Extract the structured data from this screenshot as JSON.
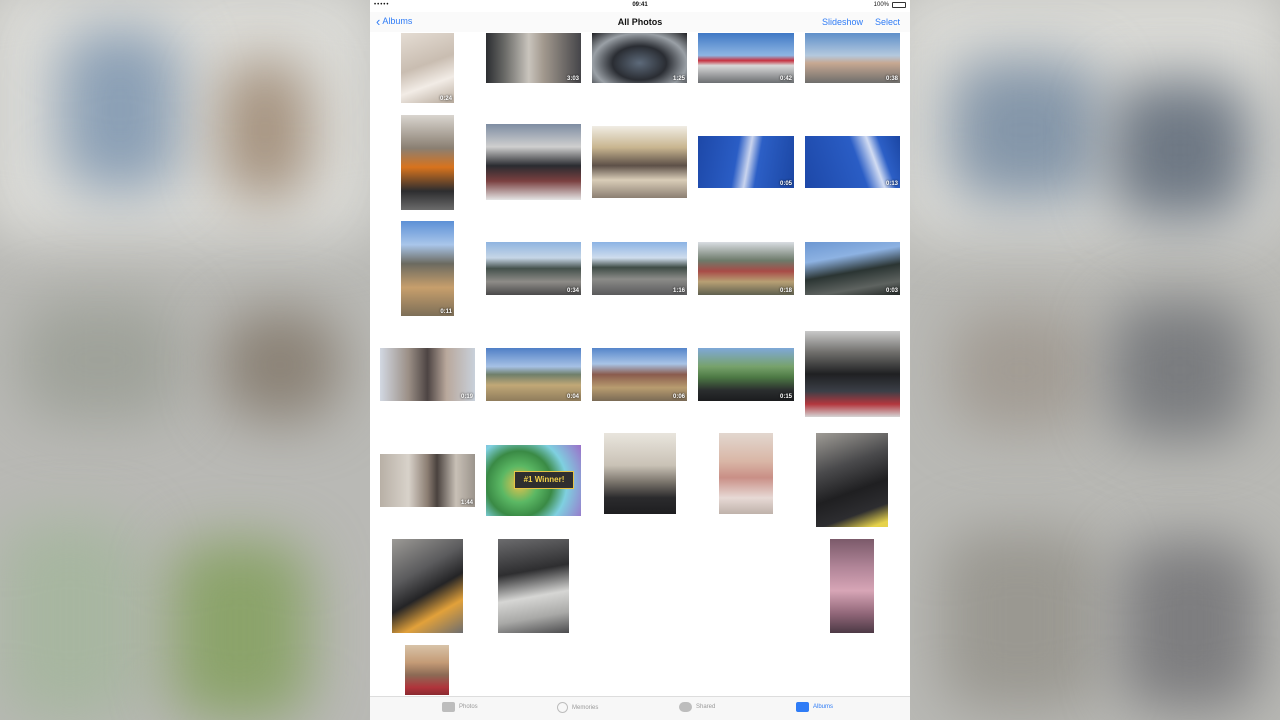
{
  "status": {
    "left": "••••• ",
    "time": "09:41",
    "battery": "100%",
    "battery_fraction": 1.0
  },
  "navbar": {
    "back_label": "Albums",
    "title": "All Photos",
    "slideshow": "Slideshow",
    "select": "Select"
  },
  "rows": [
    [
      {
        "dur": "0:24"
      },
      {
        "dur": "3:03"
      },
      {
        "dur": "1:25"
      },
      {
        "dur": "0:42"
      },
      {
        "dur": "0:38"
      }
    ],
    [
      {
        "dur": ""
      },
      {
        "dur": ""
      },
      {
        "dur": ""
      },
      {
        "dur": "0:05"
      },
      {
        "dur": "0:13"
      }
    ],
    [
      {
        "dur": "0:11"
      },
      {
        "dur": "0:34"
      },
      {
        "dur": "1:16"
      },
      {
        "dur": "0:18"
      },
      {
        "dur": "0:03"
      }
    ],
    [
      {
        "dur": "0:19"
      },
      {
        "dur": "0:04"
      },
      {
        "dur": "0:06"
      },
      {
        "dur": "0:15"
      },
      {
        "dur": ""
      }
    ],
    [
      {
        "dur": "1:44"
      },
      {
        "dur": ""
      },
      {
        "dur": ""
      },
      {
        "dur": ""
      },
      {
        "dur": ""
      }
    ],
    [
      {
        "dur": ""
      },
      {
        "dur": ""
      },
      {
        "dur": ""
      }
    ],
    [
      {
        "dur": ""
      }
    ]
  ],
  "winner_text": "#1 Winner!",
  "tabs": [
    {
      "label": "Photos",
      "icon": "photos-icon"
    },
    {
      "label": "Memories",
      "icon": "memories-icon"
    },
    {
      "label": "Shared",
      "icon": "cloud-icon"
    },
    {
      "label": "Albums",
      "icon": "albums-icon"
    }
  ],
  "colors": {
    "accent": "#2f7cf6"
  }
}
